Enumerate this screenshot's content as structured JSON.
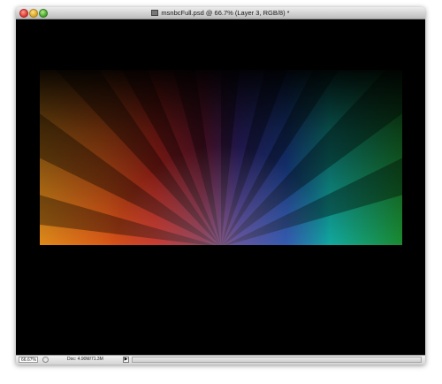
{
  "window": {
    "title": "msnbcFull.psd @ 66.7% (Layer 3, RGB/8) *"
  },
  "statusbar": {
    "zoom": "66.67%",
    "doc_info": "Doc: 4.90M/71.3M",
    "arrow": "▶"
  },
  "icons": {
    "document": "document-icon",
    "statusbar_info": "info-icon",
    "close": "close-button",
    "minimize": "minimize-button",
    "zoom": "zoom-button"
  },
  "artwork": {
    "description_colors": [
      "#f0a020",
      "#d23a1c",
      "#8c1a2a",
      "#3a2a7a",
      "#1a5ab0",
      "#10c0a0",
      "#1a9a3a"
    ]
  }
}
